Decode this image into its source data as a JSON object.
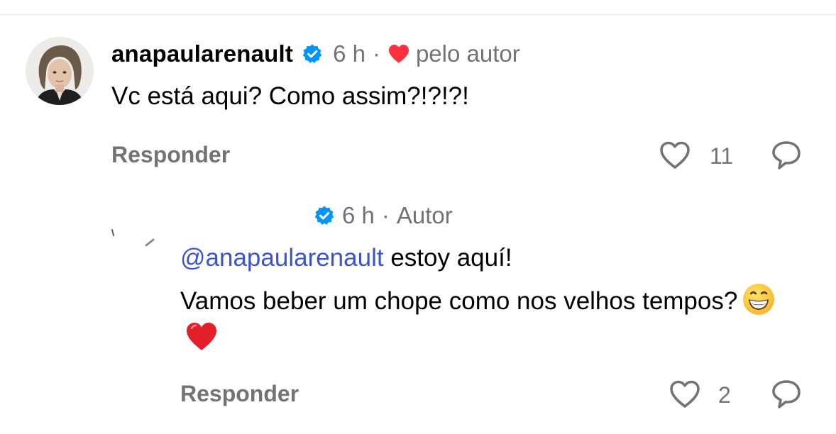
{
  "comment": {
    "username": "anapaularenault",
    "time": "6 h",
    "separator": "·",
    "liked_by_author_label": "pelo autor",
    "text": "Vc está aqui? Como assim?!?!?!",
    "reply_label": "Responder",
    "like_count": "11"
  },
  "reply": {
    "time": "6 h",
    "separator": "·",
    "author_label": "Autor",
    "mention": "@anapaularenault",
    "text_line1_rest": " estoy aquí!",
    "text_line2": "Vamos beber um chope como nos velhos tempos?",
    "emojis": [
      "grinning-face-emoji",
      "red-heart-emoji"
    ],
    "reply_label": "Responder",
    "like_count": "2"
  },
  "icons": {
    "verified": "verified-badge-icon",
    "liked": "red-heart-icon",
    "like": "heart-outline-icon",
    "share": "share-icon"
  },
  "colors": {
    "verified_blue": "#0095f6",
    "heart_red": "#ff3040",
    "meta_gray": "#737373",
    "mention_blue": "#3b55c9"
  }
}
